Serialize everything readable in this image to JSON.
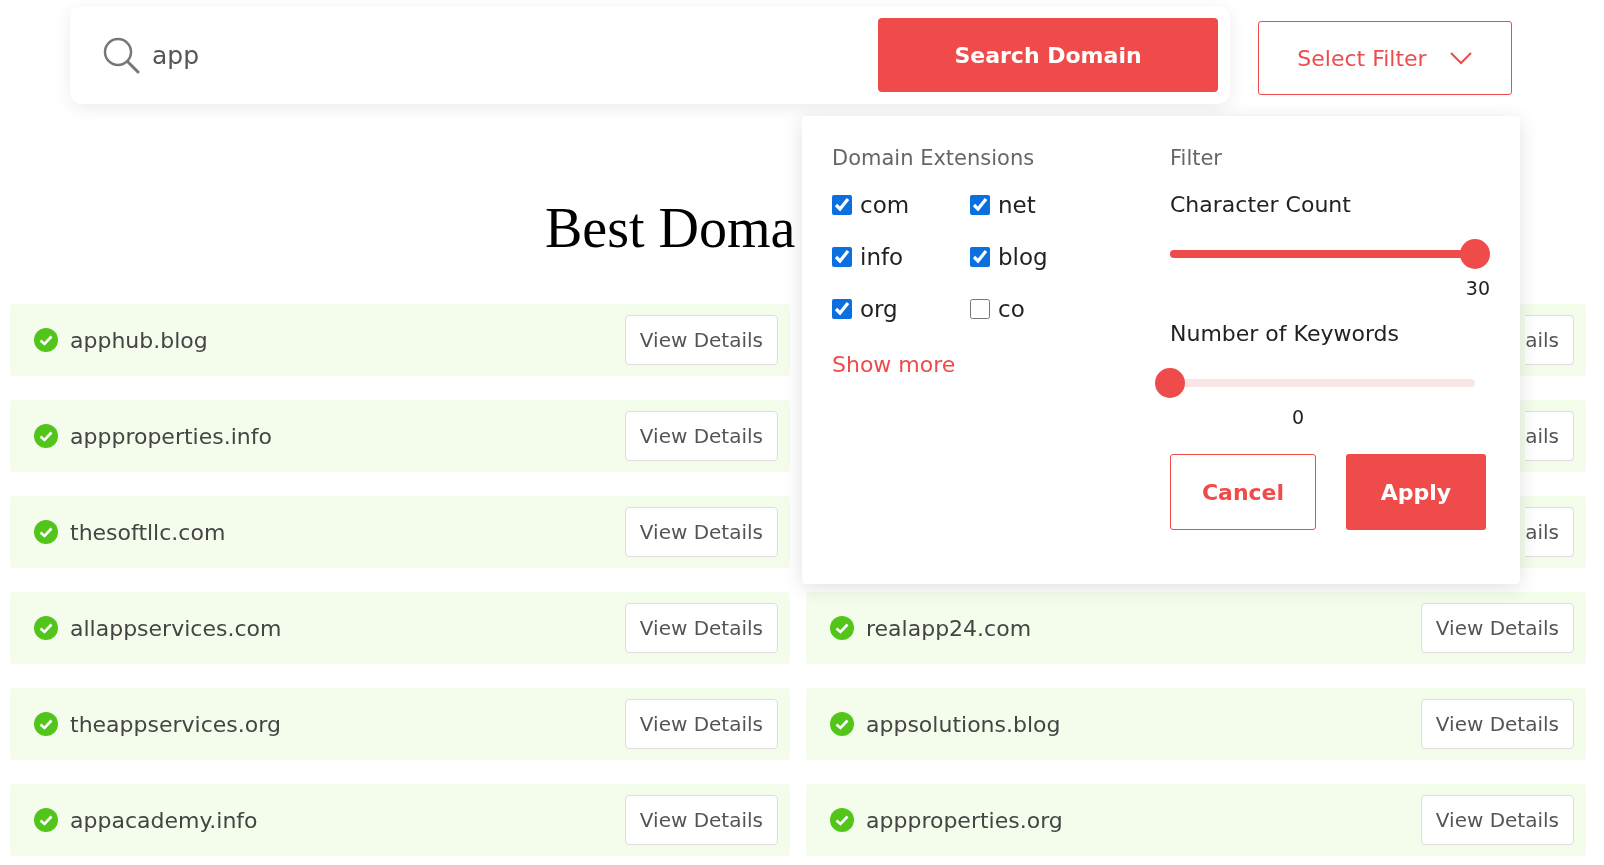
{
  "search": {
    "value": "app",
    "button": "Search Domain"
  },
  "filter_button": {
    "label": "Select Filter"
  },
  "heading": "Best Doma",
  "results": {
    "left": [
      {
        "domain": "apphub.blog",
        "button": "View Details"
      },
      {
        "domain": "appproperties.info",
        "button": "View Details"
      },
      {
        "domain": "thesoftllc.com",
        "button": "View Details"
      },
      {
        "domain": "allappservices.com",
        "button": "View Details"
      },
      {
        "domain": "theappservices.org",
        "button": "View Details"
      },
      {
        "domain": "appacademy.info",
        "button": "View Details"
      }
    ],
    "right": [
      {
        "button": "ails"
      },
      {
        "button": "ails"
      },
      {
        "button": "ails"
      },
      {
        "domain": "realapp24.com",
        "button": "View Details"
      },
      {
        "domain": "appsolutions.blog",
        "button": "View Details"
      },
      {
        "domain": "appproperties.org",
        "button": "View Details"
      }
    ]
  },
  "popup": {
    "extensions_title": "Domain Extensions",
    "extensions": [
      {
        "label": "com",
        "checked": true
      },
      {
        "label": "net",
        "checked": true
      },
      {
        "label": "info",
        "checked": true
      },
      {
        "label": "blog",
        "checked": true
      },
      {
        "label": "org",
        "checked": true
      },
      {
        "label": "co",
        "checked": false
      }
    ],
    "show_more": "Show more",
    "filter_title": "Filter",
    "sliders": [
      {
        "label": "Character Count",
        "level": 1,
        "reading": "30"
      },
      {
        "label": "Number of Keywords",
        "level": 0,
        "reading": "0"
      }
    ],
    "cancel": "Cancel",
    "apply": "Apply"
  }
}
